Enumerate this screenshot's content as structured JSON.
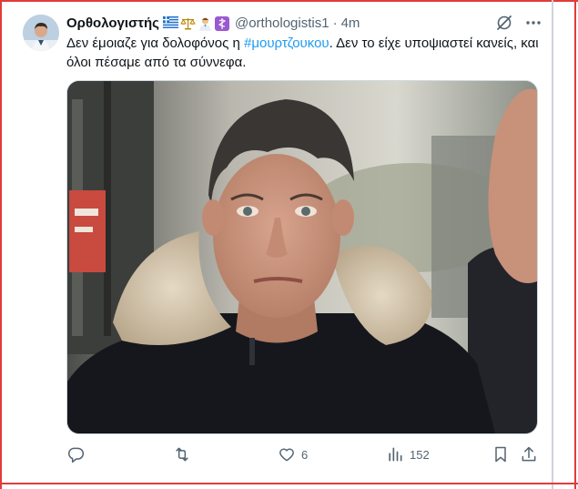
{
  "tweet": {
    "display_name": "Ορθολογιστής",
    "handle": "@orthologistis1",
    "separator": "·",
    "time": "4m",
    "text_before": "Δεν έμοιαζε για δολοφόνος η ",
    "hashtag": "#μουρτζουκου",
    "text_after": ". Δεν το είχε υποψιαστεί κανείς, και όλοι πέσαμε από τα σύννεφα.",
    "badges": [
      "greece-flag-icon",
      "scales-icon",
      "doctor-icon",
      "medical-icon"
    ]
  },
  "actions": {
    "reply_count": "",
    "retweet_count": "",
    "like_count": "6",
    "views_count": "152"
  },
  "colors": {
    "text": "#0f1419",
    "secondary": "#536471",
    "link": "#1d9bf0",
    "frame": "#e23b3b"
  }
}
